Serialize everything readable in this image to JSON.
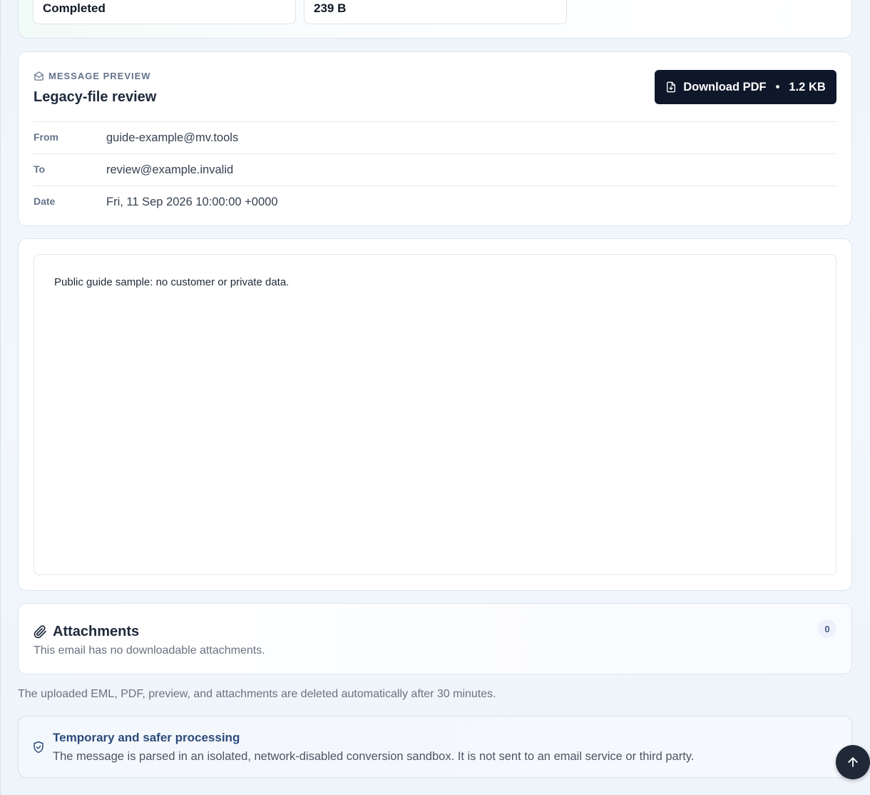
{
  "stats": {
    "status_value": "Completed",
    "size_value": "239 B"
  },
  "preview": {
    "eyebrow": "Message preview",
    "subject": "Legacy-file review",
    "download": {
      "label": "Download PDF",
      "separator": "•",
      "size": "1.2 KB"
    },
    "meta": {
      "from_label": "From",
      "from_value": "guide-example@mv.tools",
      "to_label": "To",
      "to_value": "review@example.invalid",
      "date_label": "Date",
      "date_value": "Fri, 11 Sep 2026 10:00:00 +0000"
    }
  },
  "body": {
    "text": "Public guide sample: no customer or private data."
  },
  "attachments": {
    "title": "Attachments",
    "subtitle": "This email has no downloadable attachments.",
    "count": "0"
  },
  "retention_note": "The uploaded EML, PDF, preview, and attachments are deleted automatically after 30 minutes.",
  "safety": {
    "title": "Temporary and safer processing",
    "text": "The message is parsed in an isolated, network-disabled conversion sandbox. It is not sent to an email service or third party."
  },
  "icons": {
    "eyebrow": "envelope-open-icon",
    "download": "file-download-icon",
    "attachments": "paperclip-icon",
    "safety": "shield-check-icon",
    "scroll_top": "arrow-up-icon"
  },
  "colors": {
    "button_bg": "#0f172a",
    "accent_title": "#2d4a7a",
    "badge_bg": "#eef1fb"
  }
}
